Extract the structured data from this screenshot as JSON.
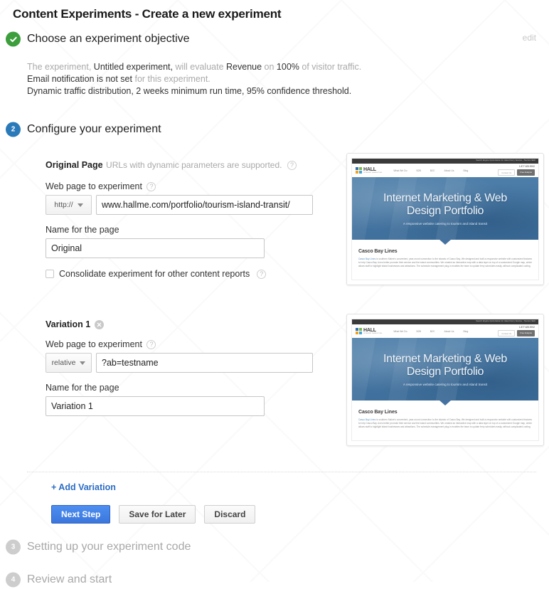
{
  "page_title": "Content Experiments - Create a new experiment",
  "colors": {
    "done_green": "#3c9e3c",
    "active_blue": "#2a7ab9",
    "idle_gray": "#cdcdcd",
    "link_blue": "#2b6dc4",
    "primary_button": "#3b76dd"
  },
  "step1": {
    "badge": "check-icon",
    "title": "Choose an experiment objective",
    "edit_label": "edit",
    "summary": {
      "line1": [
        {
          "text": "The experiment, ",
          "emphasis": false
        },
        {
          "text": "Untitled experiment,",
          "emphasis": true
        },
        {
          "text": " will evaluate ",
          "emphasis": false
        },
        {
          "text": "Revenue",
          "emphasis": true
        },
        {
          "text": " on ",
          "emphasis": false
        },
        {
          "text": "100%",
          "emphasis": true
        },
        {
          "text": " of visitor traffic.",
          "emphasis": false
        }
      ],
      "line2": [
        {
          "text": "Email notification is not set",
          "emphasis": true
        },
        {
          "text": " for this experiment.",
          "emphasis": false
        }
      ],
      "line3": [
        {
          "text": "Dynamic traffic distribution, 2 weeks minimum run time, 95% confidence threshold.",
          "emphasis": true
        }
      ]
    }
  },
  "step2": {
    "badge": "2",
    "title": "Configure your experiment",
    "original": {
      "heading": "Original Page",
      "note": "URLs with dynamic parameters are supported.",
      "help": "?",
      "url_label": "Web page to experiment",
      "protocol": "http://",
      "url_value": "www.hallme.com/portfolio/tourism-island-transit/",
      "name_label": "Name for the page",
      "name_value": "Original",
      "consolidate_label": "Consolidate experiment for other content reports",
      "consolidate_checked": false
    },
    "variation": {
      "heading": "Variation 1",
      "remove": "remove-icon",
      "url_label": "Web page to experiment",
      "protocol": "relative",
      "url_value": "?ab=testname",
      "name_label": "Name for the page",
      "name_value": "Variation 1"
    },
    "add_variation_label": "+ Add Variation",
    "buttons": {
      "next": "Next Step",
      "save": "Save for Later",
      "discard": "Discard"
    }
  },
  "step3": {
    "badge": "3",
    "title": "Setting up your experiment code"
  },
  "step4": {
    "badge": "4",
    "title": "Review and start"
  },
  "thumbnail": {
    "topbar_tag": "Search Engine Optimization for Island Ferry Service - Tourism SEO",
    "logo_text": "HALL",
    "logo_sub": "INTERNET MARKETING",
    "nav": [
      "What We Do",
      "B2B",
      "B2C",
      "About Us",
      "Blog"
    ],
    "phone": "1.877.625.5932",
    "btn_ghost": "Contact Us",
    "btn_dark": "Free Analysis",
    "hero_title_line1": "Internet Marketing & Web",
    "hero_title_line2": "Design Portfolio",
    "hero_sub": "A responsive website catering to tourism and island transit",
    "body_heading": "Casco Bay Lines",
    "body_link": "Casco Bay Lines",
    "body_text": " is southern Maine's convenient, year-round connection to the islands of Casco Bay. We designed and built a responsive website with customized features to help Casco Bay Lines better promote their service and the island communities. We created an interactive map with a data layer on top of a customized Google map, which allows staff to highlight island businesses and attractions. The schedule management plug-in enables the team to update ferry schedules easily, without complicated coding."
  }
}
